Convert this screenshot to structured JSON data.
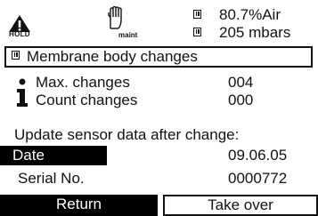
{
  "status": {
    "hold_label": "HOLD",
    "maint_label": "maint",
    "line1": "80.7%Air",
    "line2": "205 mbars",
    "hold_icon": "warning-triangle-icon",
    "maint_icon": "hand-icon",
    "channel_icon": "sensor-channel-icon"
  },
  "title": "Membrane body changes",
  "info": {
    "icon": "info-icon",
    "rows": [
      {
        "label": "Max. changes",
        "value": "004"
      },
      {
        "label": "Count changes",
        "value": "000"
      }
    ]
  },
  "update_text": "Update sensor data after change:",
  "fields": [
    {
      "label": "Date",
      "value": "09.06.05",
      "selected": true
    },
    {
      "label": "Serial No.",
      "value": "0000772",
      "selected": false
    }
  ],
  "softkeys": {
    "left": "Return",
    "right": "Take over"
  }
}
